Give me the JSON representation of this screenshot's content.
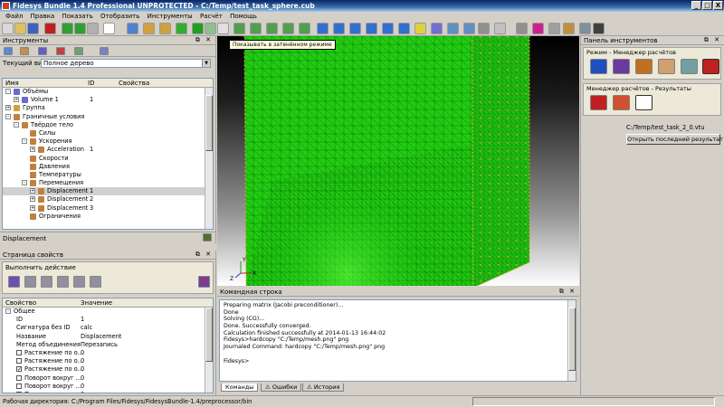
{
  "window": {
    "title": "Fidesys Bundle 1.4 Professional UNPROTECTED - C:/Temp/test_task_sphere.cub",
    "controls": [
      "_",
      "□",
      "X"
    ]
  },
  "menu": [
    "Файл",
    "Правка",
    "Показать",
    "Отобразить",
    "Инструменты",
    "Расчёт",
    "Помощь"
  ],
  "tooltip": "Показывать в затенённом режиме",
  "tools_panel": {
    "title": "Инструменты",
    "view_label": "Текущий вид",
    "view_value": "Полное дерево",
    "columns": [
      "Имя",
      "ID",
      "Свойства"
    ],
    "tree": [
      {
        "level": 0,
        "expander": "-",
        "label": "Объёмы",
        "id": "",
        "icon": "#6a6ad0"
      },
      {
        "level": 1,
        "expander": "+",
        "label": "Volume 1",
        "id": "1",
        "icon": "#6a6ad0"
      },
      {
        "level": 0,
        "expander": "+",
        "label": "Группа",
        "id": "",
        "icon": "#d0a040"
      },
      {
        "level": 0,
        "expander": "-",
        "label": "Граничные условия",
        "id": "",
        "icon": "#c08040"
      },
      {
        "level": 1,
        "expander": "-",
        "label": "Твёрдое тело",
        "id": "",
        "icon": "#c08040"
      },
      {
        "level": 2,
        "expander": "",
        "label": "Силы",
        "id": "",
        "icon": "#c08040"
      },
      {
        "level": 2,
        "expander": "-",
        "label": "Ускорения",
        "id": "",
        "icon": "#c08040"
      },
      {
        "level": 3,
        "expander": "+",
        "label": "Acceleration",
        "id": "1",
        "icon": "#c08040"
      },
      {
        "level": 2,
        "expander": "",
        "label": "Скорости",
        "id": "",
        "icon": "#c08040"
      },
      {
        "level": 2,
        "expander": "",
        "label": "Давления",
        "id": "",
        "icon": "#c08040"
      },
      {
        "level": 2,
        "expander": "",
        "label": "Температуры",
        "id": "",
        "icon": "#c08040"
      },
      {
        "level": 2,
        "expander": "-",
        "label": "Перемещения",
        "id": "",
        "icon": "#c08040"
      },
      {
        "level": 3,
        "expander": "+",
        "label": "Displacement",
        "id": "1",
        "icon": "#c08040",
        "selected": true
      },
      {
        "level": 3,
        "expander": "+",
        "label": "Displacement",
        "id": "2",
        "icon": "#c08040"
      },
      {
        "level": 3,
        "expander": "+",
        "label": "Displacement",
        "id": "3",
        "icon": "#c08040"
      },
      {
        "level": 2,
        "expander": "",
        "label": "Ограничения",
        "id": "",
        "icon": "#c08040"
      }
    ],
    "status_item": "Displacement"
  },
  "properties_panel": {
    "title": "Страница свойств",
    "action_label": "Выполнить действие",
    "columns": [
      "Свойство",
      "Значение"
    ],
    "rows": [
      {
        "type": "group",
        "label": "Общее",
        "value": ""
      },
      {
        "type": "prop",
        "label": "ID",
        "value": "1"
      },
      {
        "type": "prop",
        "label": "Сигнатура без ID",
        "value": "calc"
      },
      {
        "type": "prop",
        "label": "Название",
        "value": "Displacement"
      },
      {
        "type": "prop",
        "label": "Метод объединения",
        "value": "Перезапись"
      },
      {
        "type": "check",
        "checked": false,
        "label": "Растяжение по о...",
        "value": "0"
      },
      {
        "type": "check",
        "checked": false,
        "label": "Растяжение по о...",
        "value": "0"
      },
      {
        "type": "check",
        "checked": true,
        "label": "Растяжение по о...",
        "value": "0"
      },
      {
        "type": "check",
        "checked": false,
        "label": "Поворот вокруг ...",
        "value": "0"
      },
      {
        "type": "check",
        "checked": false,
        "label": "Поворот вокруг ...",
        "value": "0"
      },
      {
        "type": "check",
        "checked": false,
        "label": "Поворот вокруг ...",
        "value": "0"
      }
    ]
  },
  "console": {
    "title": "Командная строка",
    "lines": [
      "Preparing matrix (Jacobi preconditioner)...",
      "Done",
      "Solving (CG)...",
      "Done. Successfully converged.",
      "Calculation finished successfully at 2014-01-13 16:44:02",
      "Fidesys>hardcopy \"C:/Temp/mesh.png\" png",
      "Journaled Command: hardcopy \"C:/Temp/mesh.png\" png",
      "",
      "Fidesys>"
    ],
    "tabs": [
      "Команды",
      "Ошибки",
      "История"
    ]
  },
  "right_panel": {
    "title": "Панель инструментов",
    "mode_label": "Режим - Менеджер расчётов",
    "results_label": "Менеджер расчётов - Результаты",
    "file_path": "C:/Temp/test_task_2_0.vtu",
    "open_button": "Открыть последний результат"
  },
  "status": {
    "workdir": "Рабочая директория: C:/Program Files/Fidesys/FidesysBundle-1.4/preprocessor/bin"
  },
  "axes": {
    "x": "X",
    "y": "Y",
    "z": "Z"
  },
  "colors": {
    "mesh": "#22cc11",
    "mesh_edge": "#0a7a0a",
    "node": "#f0a020",
    "viewport_top": "#000000",
    "viewport_bottom": "#ffffff"
  }
}
